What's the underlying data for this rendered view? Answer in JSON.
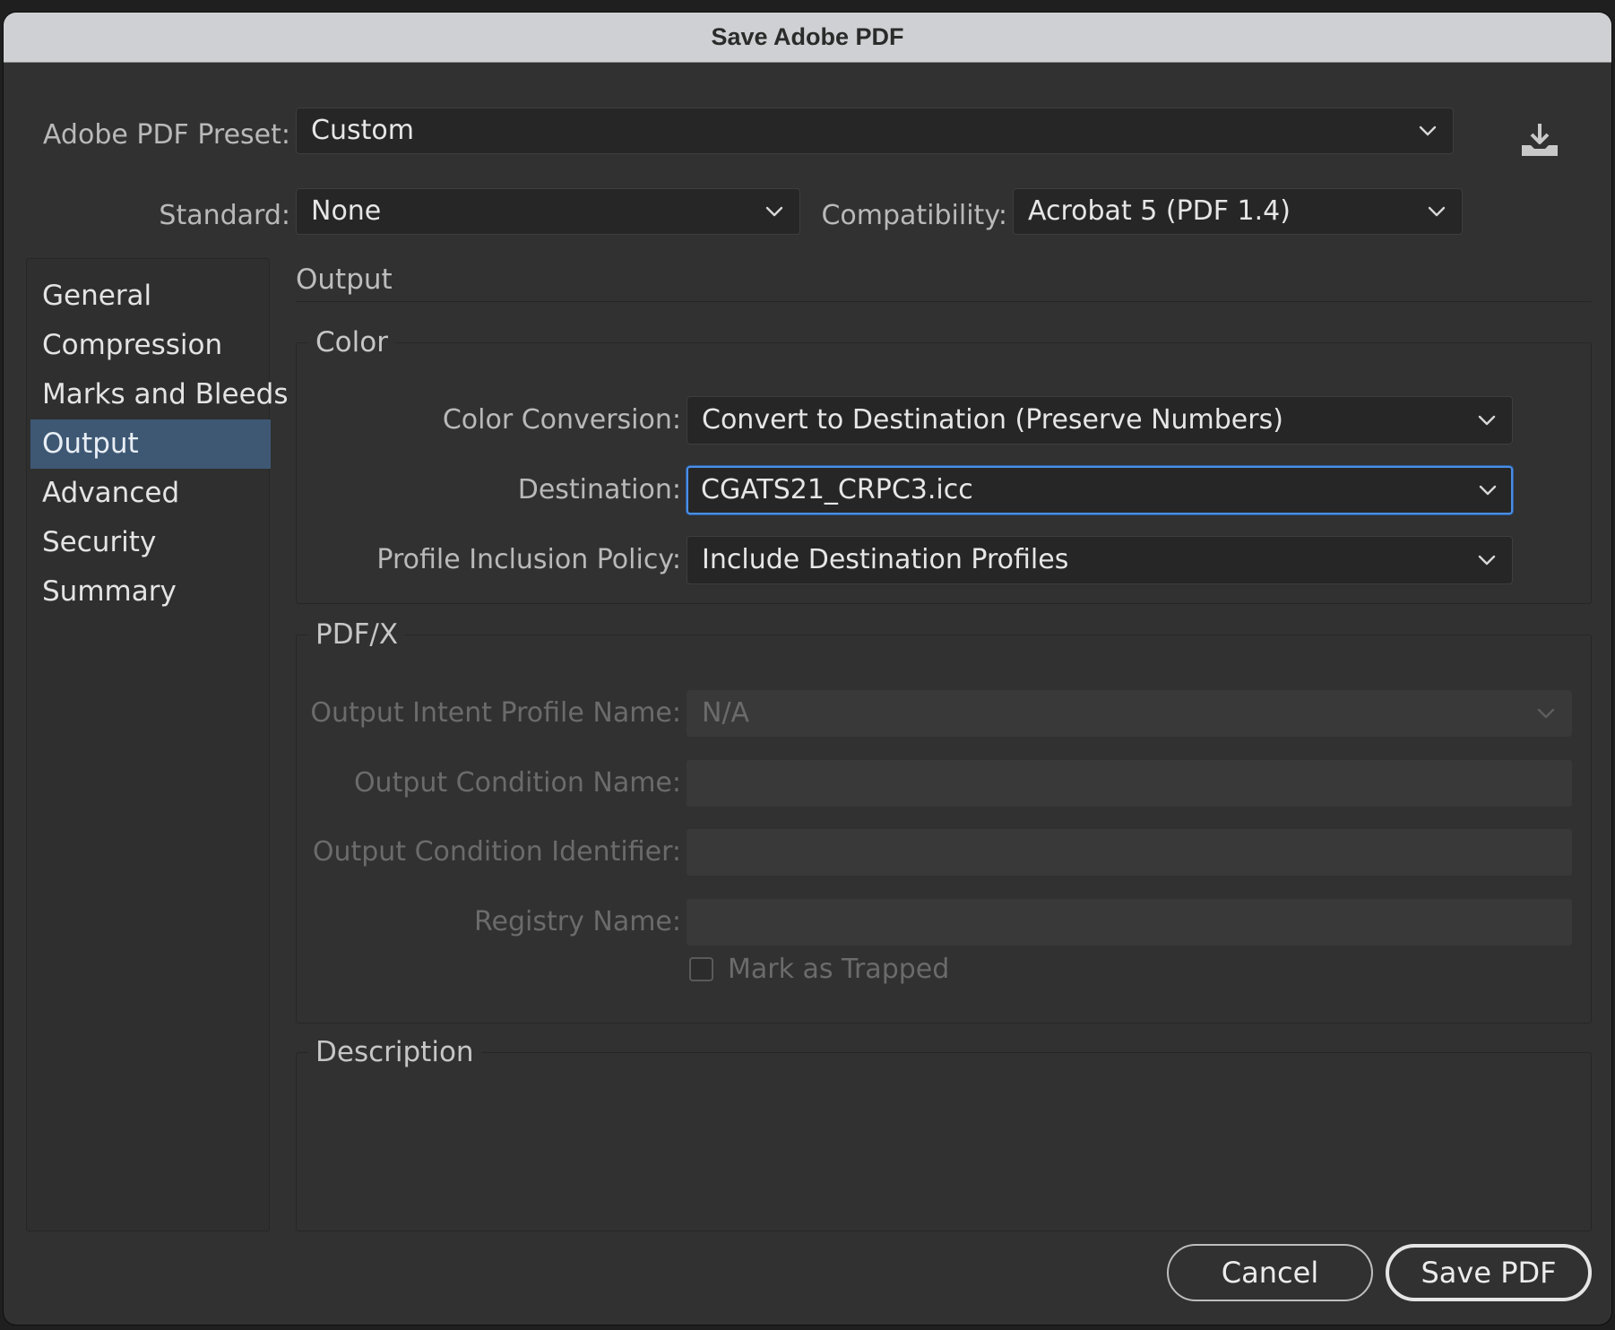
{
  "window": {
    "title": "Save Adobe PDF"
  },
  "preset": {
    "label": "Adobe PDF Preset:",
    "value": "Custom",
    "save_icon": "save-preset-icon"
  },
  "standard": {
    "label": "Standard:",
    "value": "None"
  },
  "compatibility": {
    "label": "Compatibility:",
    "value": "Acrobat 5 (PDF 1.4)"
  },
  "sidebar": {
    "items": [
      {
        "label": "General"
      },
      {
        "label": "Compression"
      },
      {
        "label": "Marks and Bleeds"
      },
      {
        "label": "Output",
        "selected": true
      },
      {
        "label": "Advanced"
      },
      {
        "label": "Security"
      },
      {
        "label": "Summary"
      }
    ]
  },
  "panel": {
    "title": "Output",
    "color": {
      "title": "Color",
      "color_conversion": {
        "label": "Color Conversion:",
        "value": "Convert to Destination (Preserve Numbers)"
      },
      "destination": {
        "label": "Destination:",
        "value": "CGATS21_CRPC3.icc"
      },
      "profile_inclusion": {
        "label": "Profile Inclusion Policy:",
        "value": "Include Destination Profiles"
      }
    },
    "pdfx": {
      "title": "PDF/X",
      "output_intent": {
        "label": "Output Intent Profile Name:",
        "value": "N/A"
      },
      "output_condition_name": {
        "label": "Output Condition Name:",
        "value": ""
      },
      "output_condition_identifier": {
        "label": "Output Condition Identifier:",
        "value": ""
      },
      "registry_name": {
        "label": "Registry Name:",
        "value": ""
      },
      "mark_as_trapped": {
        "label": "Mark as Trapped",
        "checked": false
      }
    },
    "description": {
      "title": "Description"
    }
  },
  "buttons": {
    "cancel": "Cancel",
    "save": "Save PDF"
  },
  "colors": {
    "background": "#313131",
    "field": "#262626",
    "selection": "#3e5874",
    "focus_ring": "#4b8ee5"
  }
}
